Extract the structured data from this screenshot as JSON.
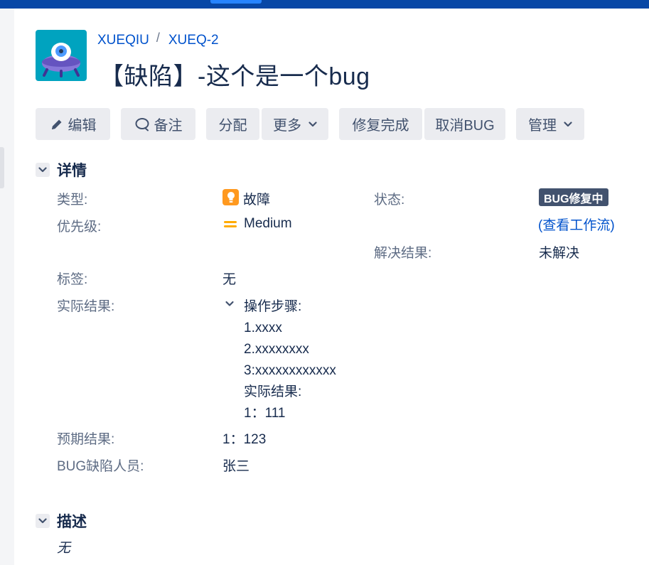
{
  "breadcrumb": {
    "project": "XUEQIU",
    "separator": "/",
    "issue_key": "XUEQ-2"
  },
  "issue": {
    "title": "【缺陷】-这个是一个bug"
  },
  "toolbar": {
    "edit": "编辑",
    "comment": "备注",
    "assign": "分配",
    "more": "更多",
    "fix_done": "修复完成",
    "cancel_bug": "取消BUG",
    "admin": "管理"
  },
  "details": {
    "heading": "详情",
    "type_label": "类型:",
    "type_value": "故障",
    "priority_label": "优先级:",
    "priority_value": "Medium",
    "status_label": "状态:",
    "status_value": "BUG修复中",
    "view_workflow": "查看工作流",
    "resolution_label": "解决结果:",
    "resolution_value": "未解决",
    "labels_label": "标签:",
    "labels_value": "无",
    "actual_label": "实际结果:",
    "actual_lines": [
      "操作步骤:",
      "1.xxxx",
      "2.xxxxxxxx",
      "3:xxxxxxxxxxxx",
      "实际结果:",
      "1：111"
    ],
    "expected_label": "预期结果:",
    "expected_value": "1：123",
    "bug_person_label": "BUG缺陷人员:",
    "bug_person_value": "张三"
  },
  "description": {
    "heading": "描述",
    "value": "无"
  },
  "colors": {
    "topbar": "#0747a6",
    "link": "#0052cc",
    "status": "#42526e",
    "bug_type": "#ff991f",
    "priority_medium": "#ffab00"
  }
}
